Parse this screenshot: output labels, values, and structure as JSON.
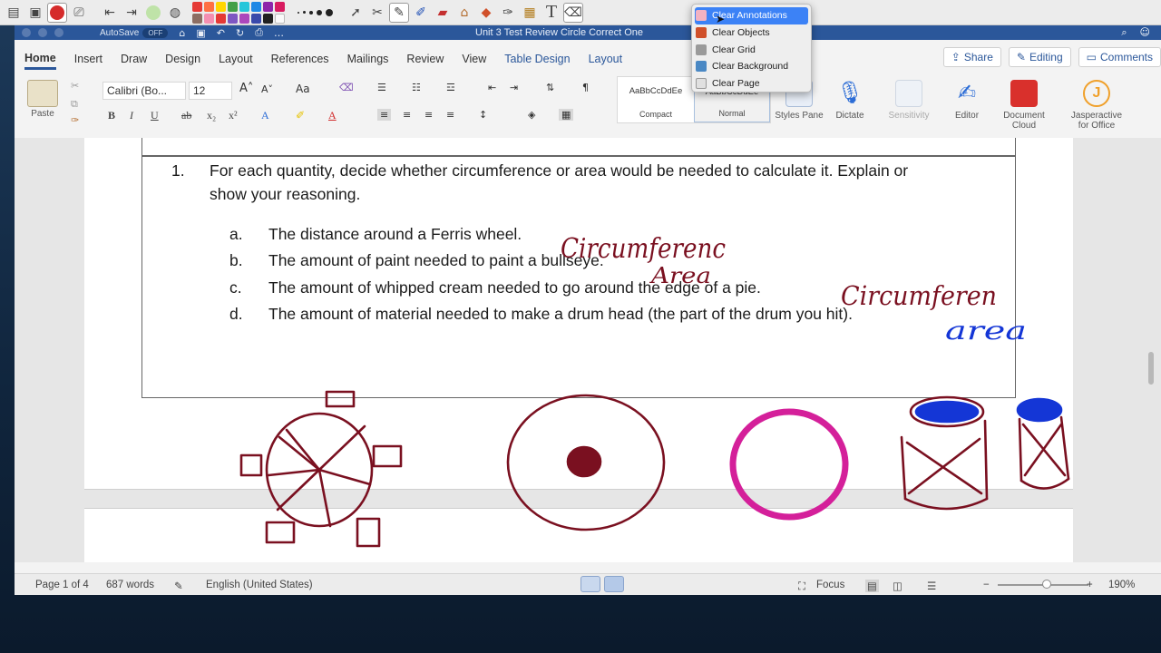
{
  "colors": {
    "ink_maroon": "#7a1020",
    "ink_blue": "#1436d6",
    "ink_magenta": "#d4209a",
    "word_blue": "#2b579a",
    "menu_highlight": "#3c82f6"
  },
  "annotation_toolbar": {
    "icons": [
      "sidebar-icon",
      "keynote-icon",
      "no-entry-icon",
      "presentation-icon",
      "back-arrow-icon",
      "forward-arrow-icon",
      "circle-icon",
      "globe-icon"
    ],
    "swatches": [
      "#e53935",
      "#ff7043",
      "#ffd600",
      "#43a047",
      "#26c6da",
      "#1e88e5",
      "#8e24aa",
      "#d81b60",
      "#8d6e63",
      "#f48fb1",
      "#e53935",
      "#7e57c2",
      "#ab47bc",
      "#3949ab",
      "#212121",
      "#fafafa"
    ],
    "tools": [
      "pointer-icon",
      "tools-icon",
      "pen-icon",
      "highlighter-icon",
      "eraser-icon",
      "shape-icon",
      "cube-icon",
      "brush-icon",
      "camera-icon",
      "text-tool-icon",
      "clear-icon"
    ]
  },
  "window": {
    "autosave": "AutoSave",
    "autosave_state": "OFF",
    "title": "Unit 3 Test Review Circle Correct One"
  },
  "tabs": [
    "Home",
    "Insert",
    "Draw",
    "Design",
    "Layout",
    "References",
    "Mailings",
    "Review",
    "View",
    "Table Design",
    "Layout"
  ],
  "share": {
    "share": "Share",
    "editing": "Editing",
    "comments": "Comments"
  },
  "ribbon": {
    "paste": "Paste",
    "font": "Calibri (Bo...",
    "size": "12",
    "styles": [
      {
        "sample": "AaBbCcDdEe",
        "name": "Compact"
      },
      {
        "sample": "AaBbCcDdEe",
        "name": "Normal"
      }
    ],
    "styles_pane": "Styles Pane",
    "dictate": "Dictate",
    "sensitivity": "Sensitivity",
    "editor": "Editor",
    "doc_cloud": "Document Cloud",
    "jasperactive": "Jasperactive for Office",
    "jasper_letter": "J"
  },
  "context_menu": {
    "items": [
      {
        "label": "Clear Annotations",
        "icon": "clear-annotations-icon"
      },
      {
        "label": "Clear Objects",
        "icon": "clear-objects-icon"
      },
      {
        "label": "Clear Grid",
        "icon": "clear-grid-icon"
      },
      {
        "label": "Clear Background",
        "icon": "clear-background-icon"
      },
      {
        "label": "Clear Page",
        "icon": "clear-page-icon"
      }
    ],
    "highlighted": "Clear Annotations"
  },
  "document": {
    "question_num": "1.",
    "question_line1": "For each quantity, decide whether circumference or area would be needed to calculate it. Explain or",
    "question_line2": "show your reasoning.",
    "items": [
      {
        "letter": "a.",
        "text": "The distance around a Ferris wheel."
      },
      {
        "letter": "b.",
        "text": "The amount of paint needed to paint a bullseye."
      },
      {
        "letter": "c.",
        "text": "The amount of whipped cream needed to go around the edge of a pie."
      },
      {
        "letter": "d.",
        "text": "The amount of material needed to make a drum head (the part of the drum you hit)."
      }
    ],
    "handwriting": [
      "Circumferenc",
      "Area",
      "Circumferen",
      "area"
    ]
  },
  "status": {
    "page": "Page 1 of 4",
    "words": "687 words",
    "language": "English (United States)",
    "focus": "Focus",
    "zoom": "190%"
  }
}
